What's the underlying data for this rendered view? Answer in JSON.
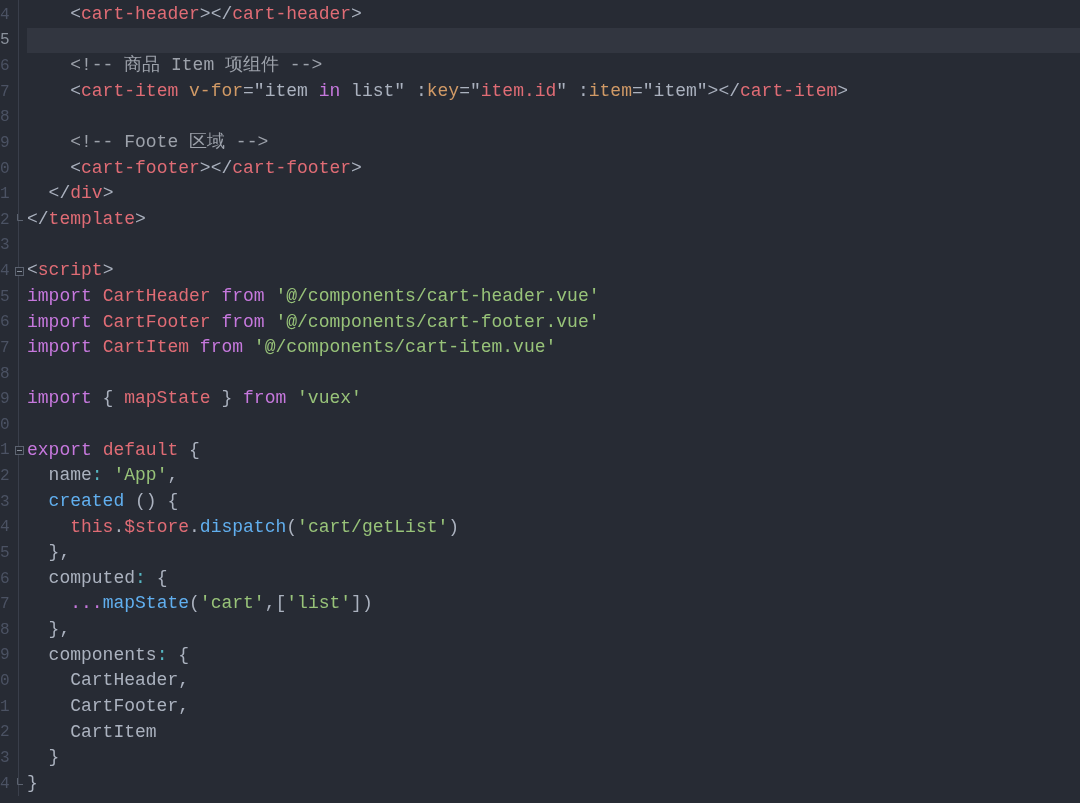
{
  "editor": {
    "lines": [
      {
        "number": "4",
        "current": false,
        "tokens": [
          {
            "text": "    <",
            "kind": "punct"
          },
          {
            "text": "cart-header",
            "kind": "tag"
          },
          {
            "text": "></",
            "kind": "punct"
          },
          {
            "text": "cart-header",
            "kind": "tag"
          },
          {
            "text": ">",
            "kind": "punct"
          }
        ]
      },
      {
        "number": "5",
        "current": true
      },
      {
        "number": "6",
        "current": false,
        "tokens": [
          {
            "text": "    <!-- 商品 Item 项组件 -->",
            "kind": "comment"
          }
        ]
      },
      {
        "number": "7",
        "current": false,
        "tokens": [
          {
            "text": "    <",
            "kind": "punct"
          },
          {
            "text": "cart-item ",
            "kind": "tag"
          },
          {
            "text": "v-for",
            "kind": "attr"
          },
          {
            "text": "=\"item ",
            "kind": "plain"
          },
          {
            "text": "in",
            "kind": "keyword"
          },
          {
            "text": " list\" :",
            "kind": "plain"
          },
          {
            "text": "key",
            "kind": "attr"
          },
          {
            "text": "=\"",
            "kind": "plain"
          },
          {
            "text": "item.id",
            "kind": "tag"
          },
          {
            "text": "\" :",
            "kind": "plain"
          },
          {
            "text": "item",
            "kind": "attr"
          },
          {
            "text": "=\"item\"",
            "kind": "plain"
          },
          {
            "text": "></",
            "kind": "punct"
          },
          {
            "text": "cart-item",
            "kind": "tag"
          },
          {
            "text": ">",
            "kind": "punct"
          }
        ]
      },
      {
        "number": "8",
        "current": false
      },
      {
        "number": "9",
        "current": false,
        "tokens": [
          {
            "text": "    <!-- Foote 区域 -->",
            "kind": "comment"
          }
        ]
      },
      {
        "number": "0",
        "current": false,
        "tokens": [
          {
            "text": "    <",
            "kind": "punct"
          },
          {
            "text": "cart-footer",
            "kind": "tag"
          },
          {
            "text": "></",
            "kind": "punct"
          },
          {
            "text": "cart-footer",
            "kind": "tag"
          },
          {
            "text": ">",
            "kind": "punct"
          }
        ]
      },
      {
        "number": "1",
        "current": false,
        "tokens": [
          {
            "text": "  </",
            "kind": "punct"
          },
          {
            "text": "div",
            "kind": "tag"
          },
          {
            "text": ">",
            "kind": "punct"
          }
        ]
      },
      {
        "number": "2",
        "fold_end": true,
        "current": false,
        "tokens": [
          {
            "text": "</",
            "kind": "punct"
          },
          {
            "text": "template",
            "kind": "tag"
          },
          {
            "text": ">",
            "kind": "punct"
          }
        ]
      },
      {
        "number": "3",
        "current": false
      },
      {
        "number": "4",
        "foldable": true,
        "current": false,
        "tokens": [
          {
            "text": "<",
            "kind": "punct"
          },
          {
            "text": "script",
            "kind": "tag"
          },
          {
            "text": ">",
            "kind": "punct"
          }
        ]
      },
      {
        "number": "5",
        "current": false,
        "tokens": [
          {
            "text": "import ",
            "kind": "keyword"
          },
          {
            "text": "CartHeader ",
            "kind": "tag"
          },
          {
            "text": "from ",
            "kind": "keyword"
          },
          {
            "text": "'@/components/cart-header.vue'",
            "kind": "string"
          }
        ]
      },
      {
        "number": "6",
        "current": false,
        "tokens": [
          {
            "text": "import ",
            "kind": "keyword"
          },
          {
            "text": "CartFooter ",
            "kind": "tag"
          },
          {
            "text": "from ",
            "kind": "keyword"
          },
          {
            "text": "'@/components/cart-footer.vue'",
            "kind": "string"
          }
        ]
      },
      {
        "number": "7",
        "current": false,
        "tokens": [
          {
            "text": "import ",
            "kind": "keyword"
          },
          {
            "text": "CartItem ",
            "kind": "tag"
          },
          {
            "text": "from ",
            "kind": "keyword"
          },
          {
            "text": "'@/components/cart-item.vue'",
            "kind": "string"
          }
        ]
      },
      {
        "number": "8",
        "current": false
      },
      {
        "number": "9",
        "current": false,
        "tokens": [
          {
            "text": "import",
            "kind": "keyword"
          },
          {
            "text": " { ",
            "kind": "plain"
          },
          {
            "text": "mapState",
            "kind": "tag"
          },
          {
            "text": " } ",
            "kind": "plain"
          },
          {
            "text": "from ",
            "kind": "keyword"
          },
          {
            "text": "'vuex'",
            "kind": "string"
          }
        ]
      },
      {
        "number": "0",
        "current": false
      },
      {
        "number": "1",
        "foldable": true,
        "current": false,
        "tokens": [
          {
            "text": "export ",
            "kind": "keyword"
          },
          {
            "text": "default",
            "kind": "tag"
          },
          {
            "text": " {",
            "kind": "plain"
          }
        ]
      },
      {
        "number": "2",
        "current": false,
        "tokens": [
          {
            "text": "  name",
            "kind": "plain"
          },
          {
            "text": ": ",
            "kind": "colon"
          },
          {
            "text": "'App'",
            "kind": "string"
          },
          {
            "text": ",",
            "kind": "plain"
          }
        ]
      },
      {
        "number": "3",
        "current": false,
        "tokens": [
          {
            "text": "  created",
            "kind": "func"
          },
          {
            "text": " () {",
            "kind": "plain"
          }
        ]
      },
      {
        "number": "4",
        "current": false,
        "tokens": [
          {
            "text": "    this",
            "kind": "tag"
          },
          {
            "text": ".",
            "kind": "plain"
          },
          {
            "text": "$store",
            "kind": "tag"
          },
          {
            "text": ".",
            "kind": "plain"
          },
          {
            "text": "dispatch",
            "kind": "func"
          },
          {
            "text": "(",
            "kind": "plain"
          },
          {
            "text": "'cart/getList'",
            "kind": "string"
          },
          {
            "text": ")",
            "kind": "plain"
          }
        ]
      },
      {
        "number": "5",
        "current": false,
        "tokens": [
          {
            "text": "  },",
            "kind": "plain"
          }
        ]
      },
      {
        "number": "6",
        "current": false,
        "tokens": [
          {
            "text": "  computed",
            "kind": "plain"
          },
          {
            "text": ":",
            "kind": "colon"
          },
          {
            "text": " {",
            "kind": "plain"
          }
        ]
      },
      {
        "number": "7",
        "current": false,
        "tokens": [
          {
            "text": "    ...",
            "kind": "keyword"
          },
          {
            "text": "mapState",
            "kind": "func"
          },
          {
            "text": "(",
            "kind": "plain"
          },
          {
            "text": "'cart'",
            "kind": "string"
          },
          {
            "text": ",[",
            "kind": "plain"
          },
          {
            "text": "'list'",
            "kind": "string"
          },
          {
            "text": "])",
            "kind": "plain"
          }
        ]
      },
      {
        "number": "8",
        "current": false,
        "tokens": [
          {
            "text": "  },",
            "kind": "plain"
          }
        ]
      },
      {
        "number": "9",
        "current": false,
        "tokens": [
          {
            "text": "  components",
            "kind": "plain"
          },
          {
            "text": ":",
            "kind": "colon"
          },
          {
            "text": " {",
            "kind": "plain"
          }
        ]
      },
      {
        "number": "0",
        "current": false,
        "tokens": [
          {
            "text": "    CartHeader,",
            "kind": "plain"
          }
        ]
      },
      {
        "number": "1",
        "current": false,
        "tokens": [
          {
            "text": "    CartFooter,",
            "kind": "plain"
          }
        ]
      },
      {
        "number": "2",
        "current": false,
        "tokens": [
          {
            "text": "    CartItem",
            "kind": "plain"
          }
        ]
      },
      {
        "number": "3",
        "current": false,
        "tokens": [
          {
            "text": "  }",
            "kind": "plain"
          }
        ]
      },
      {
        "number": "4",
        "fold_end": true,
        "current": false,
        "tokens": [
          {
            "text": "}",
            "kind": "plain"
          }
        ]
      }
    ]
  }
}
